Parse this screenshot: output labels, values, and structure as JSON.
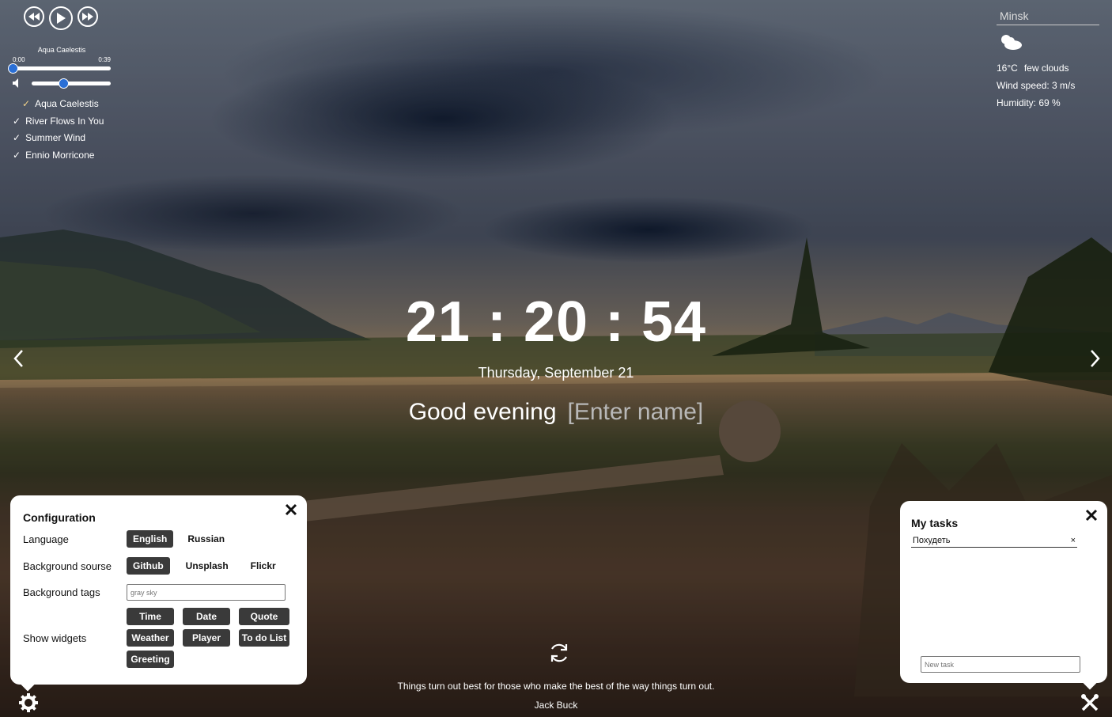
{
  "player": {
    "track_title": "Aqua Caelestis",
    "time_current": "0:00",
    "time_total": "0:39",
    "progress": 0.0,
    "volume": 0.4,
    "playlist": [
      {
        "label": "Aqua Caelestis",
        "active": true
      },
      {
        "label": "River Flows In You",
        "active": false
      },
      {
        "label": "Summer Wind",
        "active": false
      },
      {
        "label": "Ennio Morricone",
        "active": false
      }
    ]
  },
  "weather": {
    "city": "Minsk",
    "icon": "few-clouds-icon",
    "temperature": "16°C",
    "description": "few clouds",
    "wind": "Wind speed: 3 m/s",
    "humidity": "Humidity: 69 %"
  },
  "clock": {
    "time": "21 : 20 : 54"
  },
  "date": "Thursday, September 21",
  "greeting": {
    "text": "Good evening",
    "name_placeholder": "[Enter name]"
  },
  "quote": {
    "text": "Things turn out best for those who make the best of the way things turn out.",
    "author": "Jack Buck"
  },
  "config": {
    "title": "Configuration",
    "language_label": "Language",
    "languages": [
      {
        "label": "English",
        "active": true
      },
      {
        "label": "Russian",
        "active": false
      }
    ],
    "bg_source_label": "Background sourse",
    "bg_sources": [
      {
        "label": "Github",
        "active": true
      },
      {
        "label": "Unsplash",
        "active": false
      },
      {
        "label": "Flickr",
        "active": false
      }
    ],
    "bg_tags_label": "Background tags",
    "bg_tags_placeholder": "gray sky",
    "widgets_label": "Show widgets",
    "widgets": [
      {
        "label": "Time",
        "active": true
      },
      {
        "label": "Date",
        "active": true
      },
      {
        "label": "Quote",
        "active": true
      },
      {
        "label": "Weather",
        "active": true
      },
      {
        "label": "Player",
        "active": true
      },
      {
        "label": "To do List",
        "active": true
      },
      {
        "label": "Greeting",
        "active": true
      }
    ]
  },
  "todo": {
    "title": "My tasks",
    "tasks": [
      {
        "label": "Похудеть"
      }
    ],
    "task_delete": "×",
    "new_task_placeholder": "New task"
  },
  "colors": {
    "accent": "#2a6fd6",
    "active_button": "#3a3a3a",
    "playlist_check_active": "#f0d28a"
  }
}
